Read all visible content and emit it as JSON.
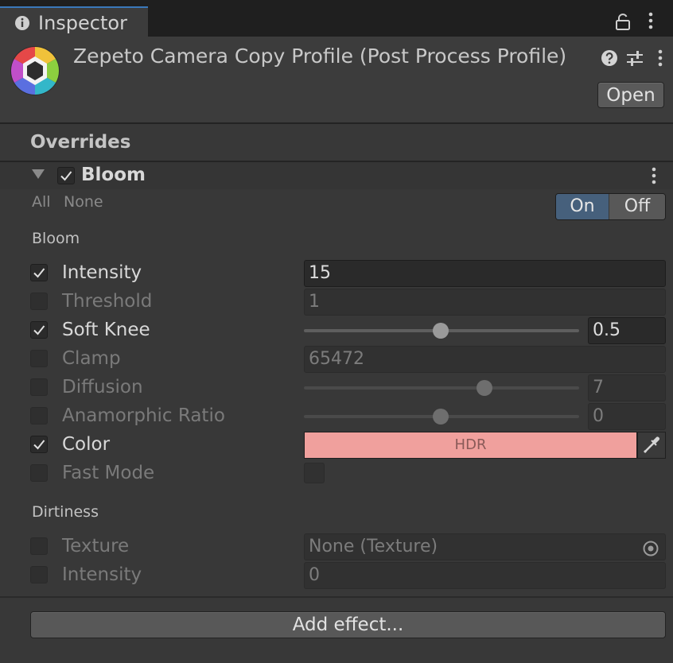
{
  "tab": {
    "label": "Inspector"
  },
  "header": {
    "title": "Zepeto Camera Copy Profile (Post Process Profile)",
    "open_label": "Open"
  },
  "overrides_label": "Overrides",
  "effect": {
    "name": "Bloom",
    "enabled": true,
    "all_label": "All",
    "none_label": "None",
    "on_label": "On",
    "off_label": "Off",
    "selected_toggle": "On"
  },
  "sections": {
    "bloom": "Bloom",
    "dirtiness": "Dirtiness"
  },
  "rows": {
    "intensity": {
      "label": "Intensity",
      "checked": true,
      "value": "15"
    },
    "threshold": {
      "label": "Threshold",
      "checked": false,
      "value": "1"
    },
    "soft_knee": {
      "label": "Soft Knee",
      "checked": true,
      "value": "0.5",
      "slider_fraction": 0.5
    },
    "clamp": {
      "label": "Clamp",
      "checked": false,
      "value": "65472"
    },
    "diffusion": {
      "label": "Diffusion",
      "checked": false,
      "value": "7",
      "slider_fraction": 0.66
    },
    "anamorphic_ratio": {
      "label": "Anamorphic Ratio",
      "checked": false,
      "value": "0",
      "slider_fraction": 0.5
    },
    "color": {
      "label": "Color",
      "checked": true,
      "value": "HDR",
      "color": "#f0a09d"
    },
    "fast_mode": {
      "label": "Fast Mode",
      "checked": false
    },
    "texture": {
      "label": "Texture",
      "checked": false,
      "value": "None (Texture)"
    },
    "dirt_intensity": {
      "label": "Intensity",
      "checked": false,
      "value": "0"
    }
  },
  "add_effect_label": "Add effect...",
  "colors": {
    "accent": "#3a79bb",
    "toggle_on": "#46607c",
    "bloom_color": "#f0a09d"
  }
}
